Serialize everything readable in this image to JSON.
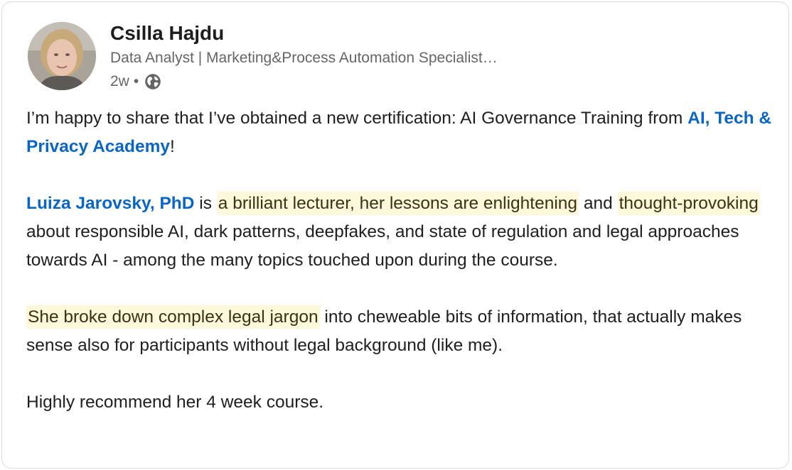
{
  "author": {
    "name": "Csilla Hajdu",
    "headline": "Data Analyst | Marketing&Process Automation Specialist…",
    "time": "2w",
    "separator": "•",
    "visibility_icon": "globe-icon"
  },
  "post": {
    "p1": {
      "t1": "I’m happy to share that I’ve obtained a new certification: AI Governance Training from ",
      "mention": "AI, Tech & Privacy Academy",
      "t2": "!"
    },
    "p2": {
      "mention": "Luiza Jarovsky, PhD",
      "t1": " is ",
      "hl1": "a brilliant lecturer, her lessons are enlightening",
      "t2": " and ",
      "hl2": "thought-provoking",
      "t3": " about responsible AI, dark patterns, deepfakes, and state of regulation and legal approaches towards AI - among the many topics touched upon during the course."
    },
    "p3": {
      "hl1": "She broke down complex legal jargon",
      "t1": " into cheweable bits of information, that actually makes sense also for participants without legal background (like me)."
    },
    "p4": {
      "t1": "Highly recommend her 4 week course."
    }
  },
  "colors": {
    "mention": "#0a66c2",
    "highlight": "#fdf8dc",
    "secondary_text": "#666666",
    "primary_text": "#1f1f1f"
  }
}
